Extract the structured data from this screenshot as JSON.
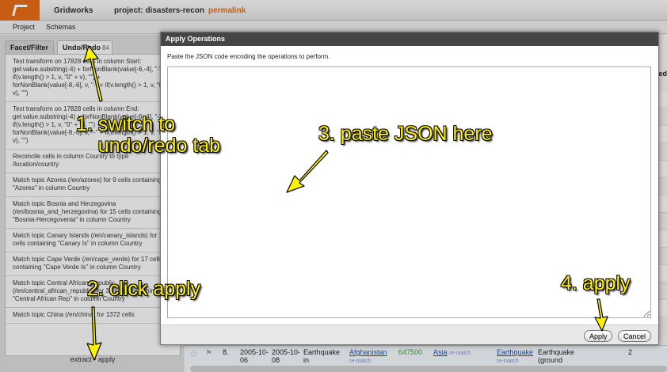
{
  "header": {
    "app_name": "Gridworks",
    "project": "project: disasters-recon",
    "permalink": "permalink"
  },
  "menubar": {
    "project": "Project",
    "schemas": "Schemas"
  },
  "left_panel": {
    "tabs": {
      "facet_filter": "Facet/Filter",
      "undo_redo": "Undo/Redo",
      "undo_redo_count": "84"
    },
    "history": [
      "Text transform on 17828 cells in column Start:\ngel:value.substring(-4) + forNonBlank(value[-6,-4], \"-\" + if(v.length() > 1, v, \"0\" + v), \"\") + forNonBlank(value[-8,-6], v, \"-\" + if(v.length() > 1, v, \"0\" + v), \"\")",
      "Text transform on 17828 cells in column End:\ngel:value.substring(-4) + forNonBlank(value[-6,-4], \"-\" + if(v.length() > 1, v, \"0\" + v), \"\") + forNonBlank(value[-8,-6], v, \"-\" + if(v.length() > 1, v, \"0\" + v), \"\")",
      "Reconcile cells in column Country to type /location/country",
      "Match topic Azores (/en/azores) for 9 cells containing \"Azores\" in column Country",
      "Match topic Bosnia and Herzegovina (/en/bosnia_and_herzegovina) for 15 cells containing \"Bosnia-Hercegovenia\" in column Country",
      "Match topic Canary Islands (/en/canary_islands) for 15 cells containing \"Canary Is\" in column Country",
      "Match topic Cape Verde (/en/cape_verde) for 17 cells containing \"Cape Verde Is\" in column Country",
      "Match topic Central African Republic (/en/central_african_republic) for 39 cells containing \"Central African Rep\" in column Country",
      "Match topic China (/en/china) for 1372 cells"
    ],
    "extract_apply": "extract • apply"
  },
  "background_table": {
    "column_fragment": "ed",
    "row": {
      "number": "8.",
      "start": "2005-10-\n06",
      "end": "2005-10-\n08",
      "type": "Earthquake\nin",
      "country": "Afghanistan",
      "country_action": "re-match",
      "population": "647500",
      "continent": "Asia",
      "continent_action": "re-match",
      "event": "Earthquake",
      "event_action": "re-match",
      "event_desc": "Earthquake\n(ground",
      "count": "2"
    }
  },
  "dialog": {
    "title": "Apply Operations",
    "instruction": "Paste the JSON code encoding the operations to perform.",
    "json_value": "",
    "apply_label": "Apply",
    "cancel_label": "Cancel"
  },
  "annotations": {
    "step1": "1. switch to\n    undo/redo tab",
    "step2": "2. click apply",
    "step3": "3. paste JSON here",
    "step4": "4. apply"
  },
  "colors": {
    "accent": "#e36a16",
    "annotation": "#fff200",
    "dialog_title_bg": "#454545"
  }
}
